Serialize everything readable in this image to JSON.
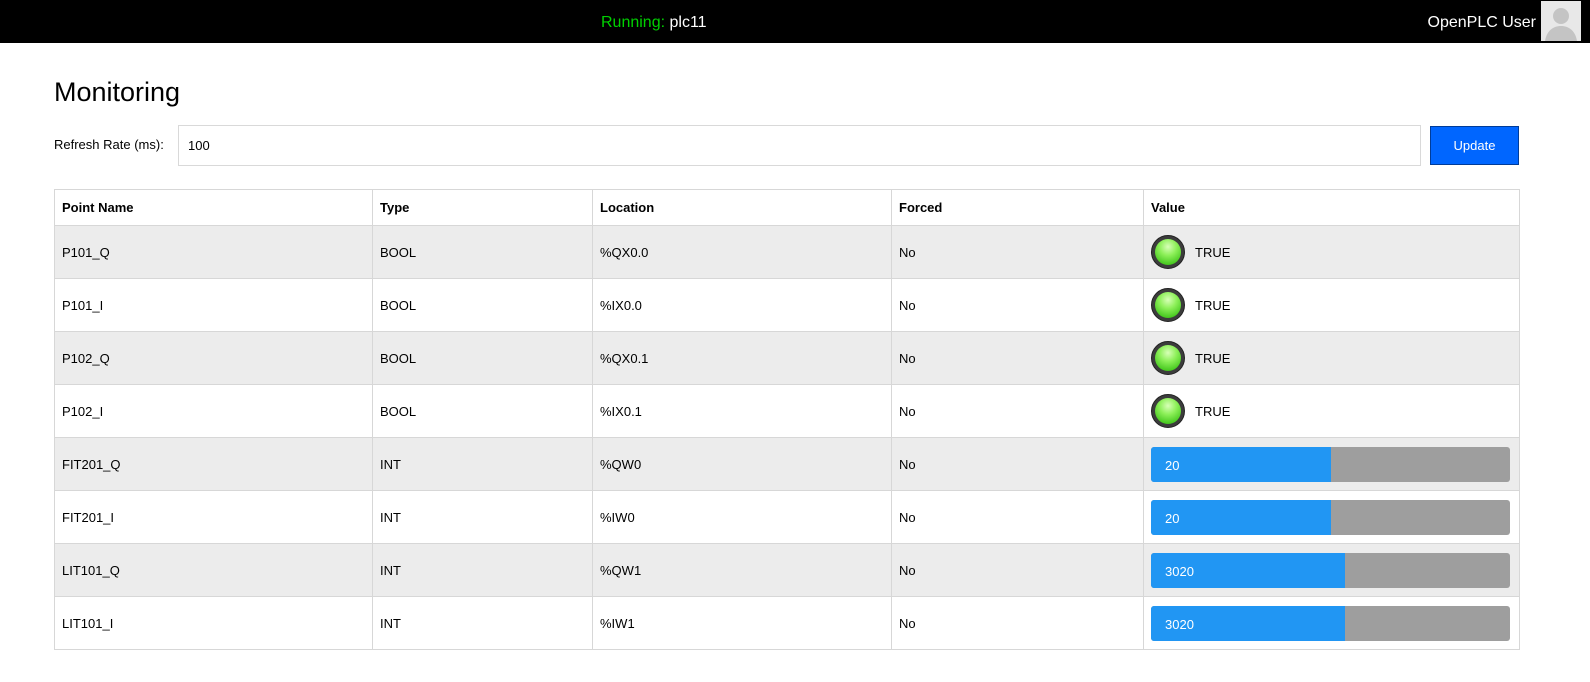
{
  "topbar": {
    "status_label": "Running:",
    "program_name": "plc11",
    "user_name": "OpenPLC User"
  },
  "page": {
    "title": "Monitoring",
    "refresh_label": "Refresh Rate (ms):",
    "refresh_value": "100",
    "update_label": "Update"
  },
  "table": {
    "headers": [
      "Point Name",
      "Type",
      "Location",
      "Forced",
      "Value"
    ],
    "rows": [
      {
        "name": "P101_Q",
        "type": "BOOL",
        "location": "%QX0.0",
        "forced": "No",
        "value": "TRUE"
      },
      {
        "name": "P101_I",
        "type": "BOOL",
        "location": "%IX0.0",
        "forced": "No",
        "value": "TRUE"
      },
      {
        "name": "P102_Q",
        "type": "BOOL",
        "location": "%QX0.1",
        "forced": "No",
        "value": "TRUE"
      },
      {
        "name": "P102_I",
        "type": "BOOL",
        "location": "%IX0.1",
        "forced": "No",
        "value": "TRUE"
      },
      {
        "name": "FIT201_Q",
        "type": "INT",
        "location": "%QW0",
        "forced": "No",
        "value": "20",
        "bar_fraction": 0.5
      },
      {
        "name": "FIT201_I",
        "type": "INT",
        "location": "%IW0",
        "forced": "No",
        "value": "20",
        "bar_fraction": 0.5
      },
      {
        "name": "LIT101_Q",
        "type": "INT",
        "location": "%QW1",
        "forced": "No",
        "value": "3020",
        "bar_fraction": 0.54
      },
      {
        "name": "LIT101_I",
        "type": "INT",
        "location": "%IW1",
        "forced": "No",
        "value": "3020",
        "bar_fraction": 0.54
      }
    ]
  },
  "colors": {
    "topbar_bg": "#000000",
    "running_green": "#00d000",
    "update_button": "#0066ff",
    "bar_fill": "#2196f3",
    "bar_track": "#9e9e9e",
    "led_green": "#45c81e"
  }
}
